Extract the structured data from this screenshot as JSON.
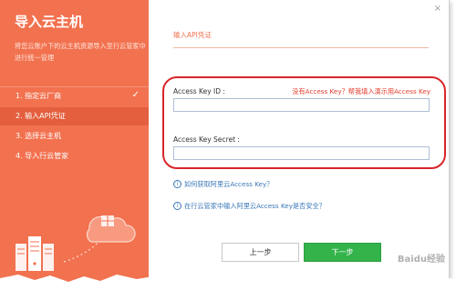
{
  "sidebar": {
    "title": "导入云主机",
    "description": "将您云账户下的云主机资源导入至行云管家中进行统一管理",
    "steps": [
      {
        "label": "1. 指定云厂商",
        "done": true
      },
      {
        "label": "2. 输入API凭证",
        "active": true
      },
      {
        "label": "3. 选择云主机"
      },
      {
        "label": "4. 导入行云管家"
      }
    ],
    "check_icon": "✓"
  },
  "main": {
    "close_icon": "×",
    "section_title": "输入API凭证",
    "access_key_id": {
      "label": "Access Key ID :",
      "value": ""
    },
    "no_key_link": "没有Access Key？帮我填入演示用Access Key",
    "access_key_secret": {
      "label": "Access Key Secret :",
      "value": ""
    },
    "info_links": [
      "如何获取阿里云Access Key？",
      "在行云管家中输入阿里云Access Key是否安全？"
    ],
    "prev_button": "上一步",
    "next_button": "下一步"
  },
  "watermark": "Baidu经验",
  "colors": {
    "accent": "#f2714f",
    "highlight_ring": "#d9252a",
    "primary_button": "#33b34a",
    "link": "#3a77b8"
  }
}
